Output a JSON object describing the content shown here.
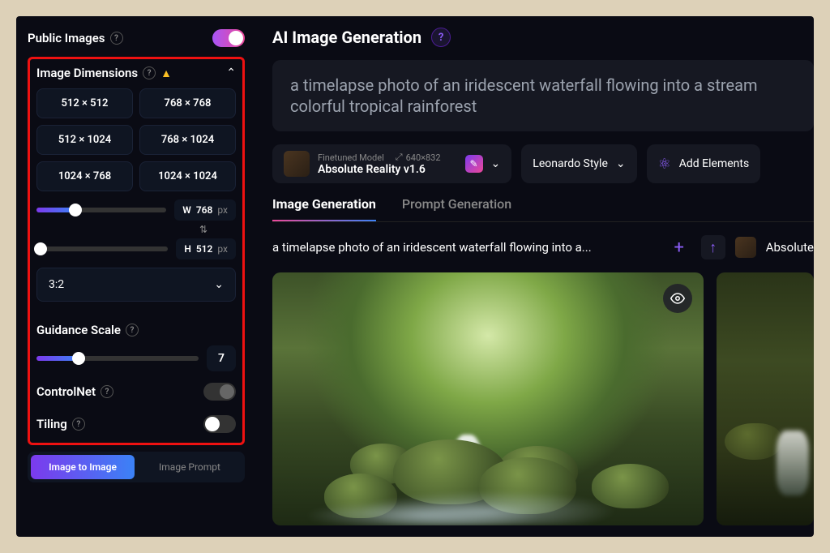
{
  "sidebar": {
    "publicImages": {
      "label": "Public Images",
      "enabled": true
    },
    "imageDimensions": {
      "label": "Image Dimensions",
      "warning": true,
      "presets": [
        "512 × 512",
        "768 × 768",
        "512 × 1024",
        "768 × 1024",
        "1024 × 768",
        "1024 × 1024"
      ],
      "width": {
        "label": "W",
        "value": "768",
        "unit": "px",
        "percent": 30
      },
      "height": {
        "label": "H",
        "value": "512",
        "unit": "px",
        "percent": 3
      },
      "ratio": "3:2"
    },
    "guidance": {
      "label": "Guidance Scale",
      "value": "7",
      "percent": 26
    },
    "controlNet": {
      "label": "ControlNet",
      "enabled": false
    },
    "tiling": {
      "label": "Tiling",
      "enabled": false
    },
    "bottomTabs": {
      "a": "Image to Image",
      "b": "Image Prompt"
    }
  },
  "main": {
    "title": "AI Image Generation",
    "prompt": "a timelapse photo of an iridescent waterfall flowing into a stream colorful tropical rainforest",
    "model": {
      "label": "Finetuned Model",
      "name": "Absolute Reality v1.6",
      "dims": "640×832"
    },
    "styleChip": "Leonardo Style",
    "elementsChip": "Add Elements",
    "tabs": {
      "a": "Image Generation",
      "b": "Prompt Generation"
    },
    "resultPrompt": "a timelapse photo of an iridescent waterfall flowing into a...",
    "resultModel": "Absolute"
  }
}
